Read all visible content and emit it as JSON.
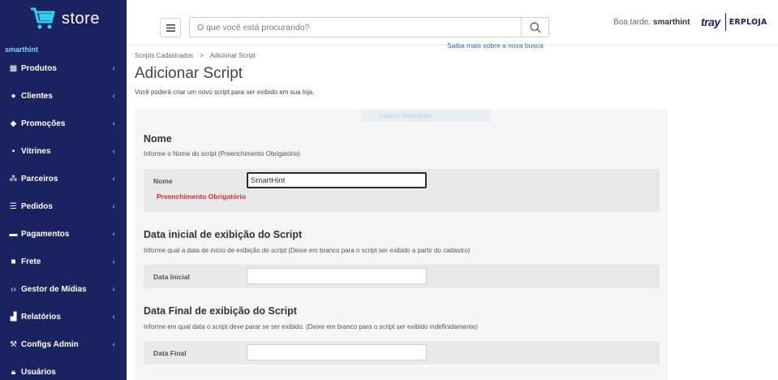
{
  "app": {
    "logo_text": "store",
    "store_name": "smarthint"
  },
  "sidebar": {
    "items": [
      {
        "label": "Produtos",
        "icon": "box-icon"
      },
      {
        "label": "Clientes",
        "icon": "user-icon"
      },
      {
        "label": "Promoções",
        "icon": "tag-icon"
      },
      {
        "label": "Vitrines",
        "icon": "grid-icon"
      },
      {
        "label": "Parceiros",
        "icon": "users-icon"
      },
      {
        "label": "Pedidos",
        "icon": "list-icon"
      },
      {
        "label": "Pagamentos",
        "icon": "card-icon"
      },
      {
        "label": "Frete",
        "icon": "truck-icon"
      },
      {
        "label": "Gestor de Mídias",
        "icon": "code-icon"
      },
      {
        "label": "Relatórios",
        "icon": "chart-icon"
      },
      {
        "label": "Configs Admin",
        "icon": "wrench-icon"
      },
      {
        "label": "Usuários",
        "icon": "lock-icon"
      }
    ]
  },
  "header": {
    "search_placeholder": "O que você está procurando?",
    "search_link": "Saiba mais sobre a nova busca",
    "greeting_prefix": "Boa tarde,",
    "greeting_user": "smarthint",
    "brand_tray": "tray",
    "brand_erp": "ERPLOJA"
  },
  "breadcrumb": {
    "items": [
      "Scripts Cadastrados",
      "Adicionar Script"
    ],
    "separator": ">"
  },
  "page": {
    "title": "Adicionar Script",
    "description": "Você poderá criar um novo script para ser exibido em sua loja.",
    "ghost_label": "Capture Retangular"
  },
  "sections": {
    "nome": {
      "title": "Nome",
      "description": "Informe o Nome do script (Preenchimento Obrigatório)",
      "field_label": "Nome",
      "field_value": "SmartHint",
      "error": "Preenchimento Obrigatório"
    },
    "data_inicial": {
      "title": "Data inicial de exibição do Script",
      "description": "Informe qual a data de início de exibição do script (Deixe em branco para o script ser exibido a partir do cadastro)",
      "field_label": "Data Inicial",
      "field_value": ""
    },
    "data_final": {
      "title": "Data Final de exibição do Script",
      "description": "Informe em qual data o script deve parar se ser exibido. (Deixe em branco para o script ser exibido indefinidamente)",
      "field_label": "Data Final",
      "field_value": ""
    }
  },
  "colors": {
    "sidebar_bg": "#1a2360",
    "store_name": "#7fd3ff",
    "error": "#d62b2b",
    "link": "#2a6ab5"
  }
}
